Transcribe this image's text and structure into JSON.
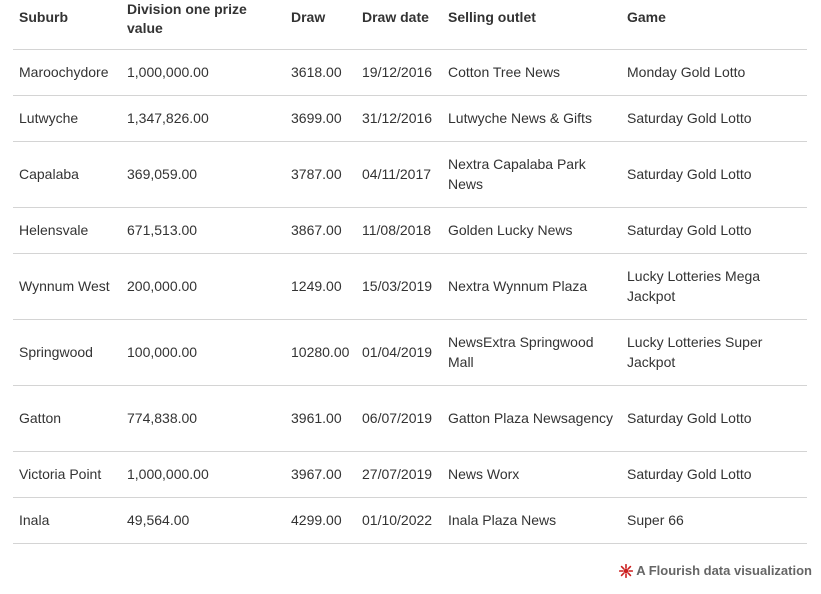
{
  "chart_data": {
    "type": "table",
    "columns": [
      "Suburb",
      "Division one prize value",
      "Draw",
      "Draw date",
      "Selling outlet",
      "Game"
    ],
    "rows": [
      {
        "suburb": "Maroochydore",
        "prize": "1,000,000.00",
        "draw": "3618.00",
        "date": "19/12/2016",
        "outlet": "Cotton Tree News",
        "game": "Monday Gold Lotto"
      },
      {
        "suburb": "Lutwyche",
        "prize": "1,347,826.00",
        "draw": "3699.00",
        "date": "31/12/2016",
        "outlet": "Lutwyche News & Gifts",
        "game": "Saturday Gold Lotto"
      },
      {
        "suburb": "Capalaba",
        "prize": "369,059.00",
        "draw": "3787.00",
        "date": "04/11/2017",
        "outlet": "Nextra Capalaba Park News",
        "game": "Saturday Gold Lotto"
      },
      {
        "suburb": "Helensvale",
        "prize": "671,513.00",
        "draw": "3867.00",
        "date": "11/08/2018",
        "outlet": "Golden Lucky News",
        "game": "Saturday Gold Lotto"
      },
      {
        "suburb": "Wynnum West",
        "prize": "200,000.00",
        "draw": "1249.00",
        "date": "15/03/2019",
        "outlet": "Nextra Wynnum Plaza",
        "game": "Lucky Lotteries Mega Jackpot"
      },
      {
        "suburb": "Springwood",
        "prize": "100,000.00",
        "draw": "10280.00",
        "date": "01/04/2019",
        "outlet": "NewsExtra Springwood Mall",
        "game": "Lucky Lotteries Super Jackpot"
      },
      {
        "suburb": "Gatton",
        "prize": "774,838.00",
        "draw": "3961.00",
        "date": "06/07/2019",
        "outlet": "Gatton Plaza Newsagency",
        "game": "Saturday Gold Lotto"
      },
      {
        "suburb": "Victoria Point",
        "prize": "1,000,000.00",
        "draw": "3967.00",
        "date": "27/07/2019",
        "outlet": "News Worx",
        "game": "Saturday Gold Lotto"
      },
      {
        "suburb": "Inala",
        "prize": "49,564.00",
        "draw": "4299.00",
        "date": "01/10/2022",
        "outlet": "Inala Plaza News",
        "game": "Super 66"
      }
    ]
  },
  "footer": {
    "text": "A Flourish data visualization",
    "logo_icon": "flourish-logo-icon",
    "logo_color": "#cc1f1f"
  },
  "colors": {
    "text": "#333333",
    "rule": "#d4d4d4",
    "footer_text": "#666666"
  }
}
